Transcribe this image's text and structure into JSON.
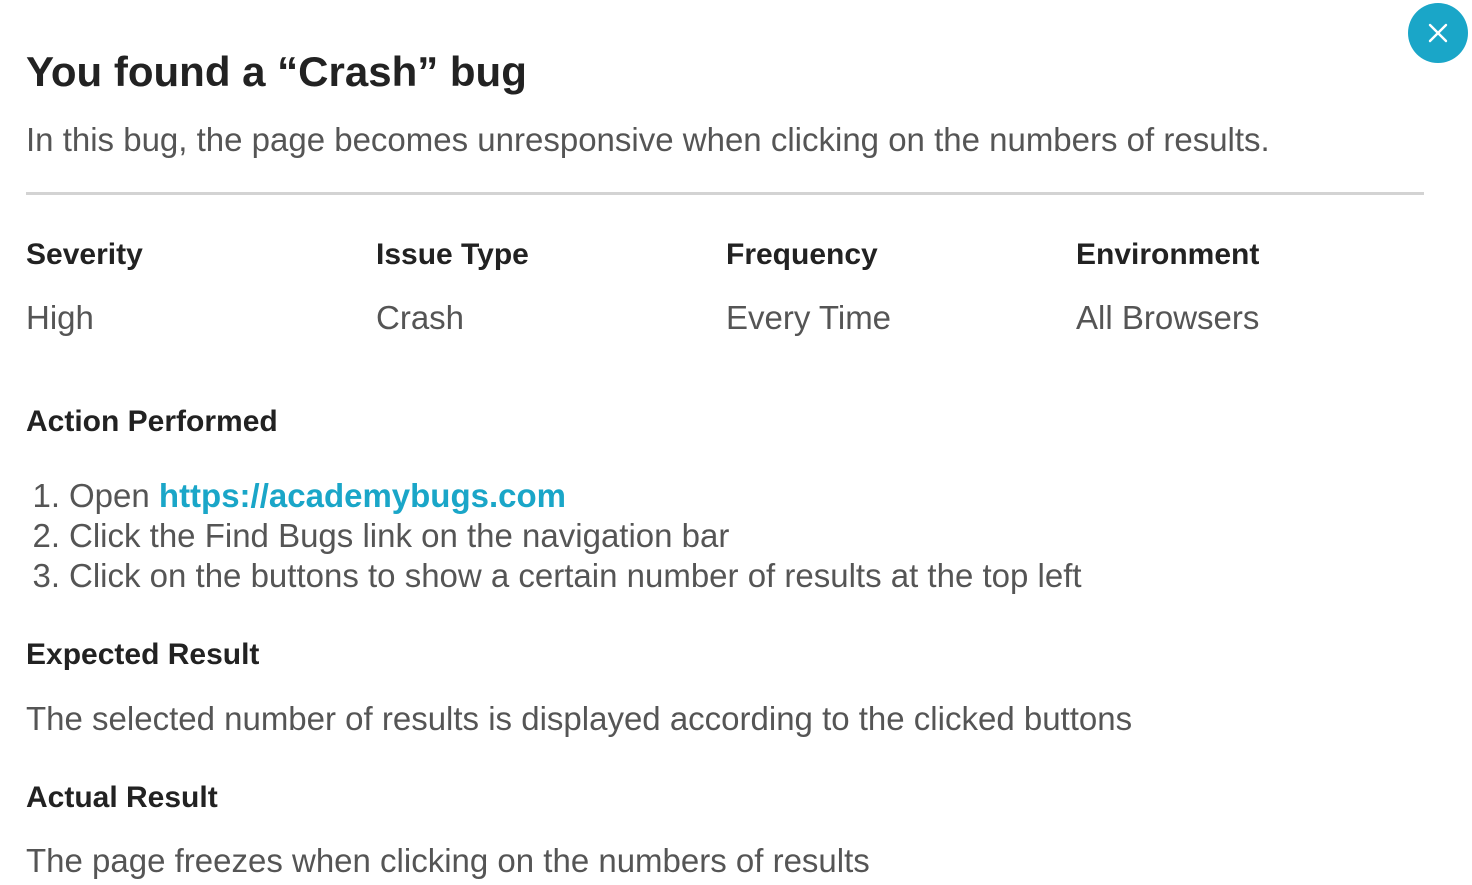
{
  "modal": {
    "title": "You found a “Crash” bug",
    "subtitle": "In this bug, the page becomes unresponsive when clicking on the numbers of results.",
    "close_icon": "close-icon",
    "accent_color": "#1aa6c8"
  },
  "meta": {
    "severity": {
      "label": "Severity",
      "value": "High"
    },
    "issue_type": {
      "label": "Issue Type",
      "value": "Crash"
    },
    "frequency": {
      "label": "Frequency",
      "value": "Every Time"
    },
    "environment": {
      "label": "Environment",
      "value": "All Browsers"
    }
  },
  "action_performed": {
    "heading": "Action Performed",
    "steps": [
      {
        "number": "1.",
        "text": "Open ",
        "link": "https://academybugs.com"
      },
      {
        "number": "2.",
        "text": "Click the Find Bugs link on the navigation bar"
      },
      {
        "number": "3.",
        "text": "Click on the buttons to show a certain number of results at the top left"
      }
    ]
  },
  "expected_result": {
    "heading": "Expected Result",
    "text": "The selected number of results is displayed according to the clicked buttons"
  },
  "actual_result": {
    "heading": "Actual Result",
    "text": "The page freezes when clicking on the numbers of results"
  }
}
